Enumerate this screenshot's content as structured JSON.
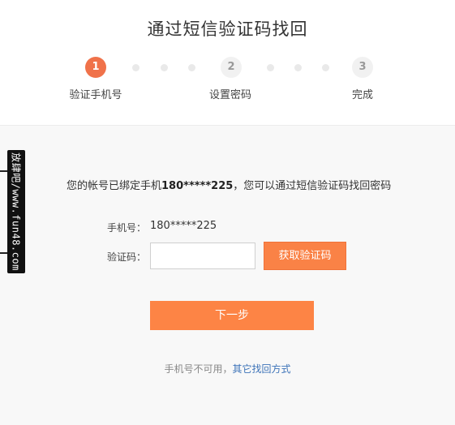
{
  "page_title": "通过短信验证码找回",
  "steps": [
    {
      "number": "1",
      "label": "验证手机号",
      "active": true
    },
    {
      "number": "2",
      "label": "设置密码",
      "active": false
    },
    {
      "number": "3",
      "label": "完成",
      "active": false
    }
  ],
  "watermark_text": "放肆吧/www.fun48.com",
  "notice": {
    "prefix": "您的帐号已绑定手机",
    "phone": "180*****225",
    "suffix": "，您可以通过短信验证码找回密码"
  },
  "form": {
    "phone_label": "手机号：",
    "phone_value": "180*****225",
    "code_label": "验证码：",
    "code_value": "",
    "get_code_button": "获取验证码",
    "next_button": "下一步"
  },
  "alternative": {
    "text": "手机号不可用，",
    "link": "其它找回方式"
  },
  "colors": {
    "accent": "#fa8246",
    "active_step": "#f0724a",
    "link": "#3d73b8"
  }
}
